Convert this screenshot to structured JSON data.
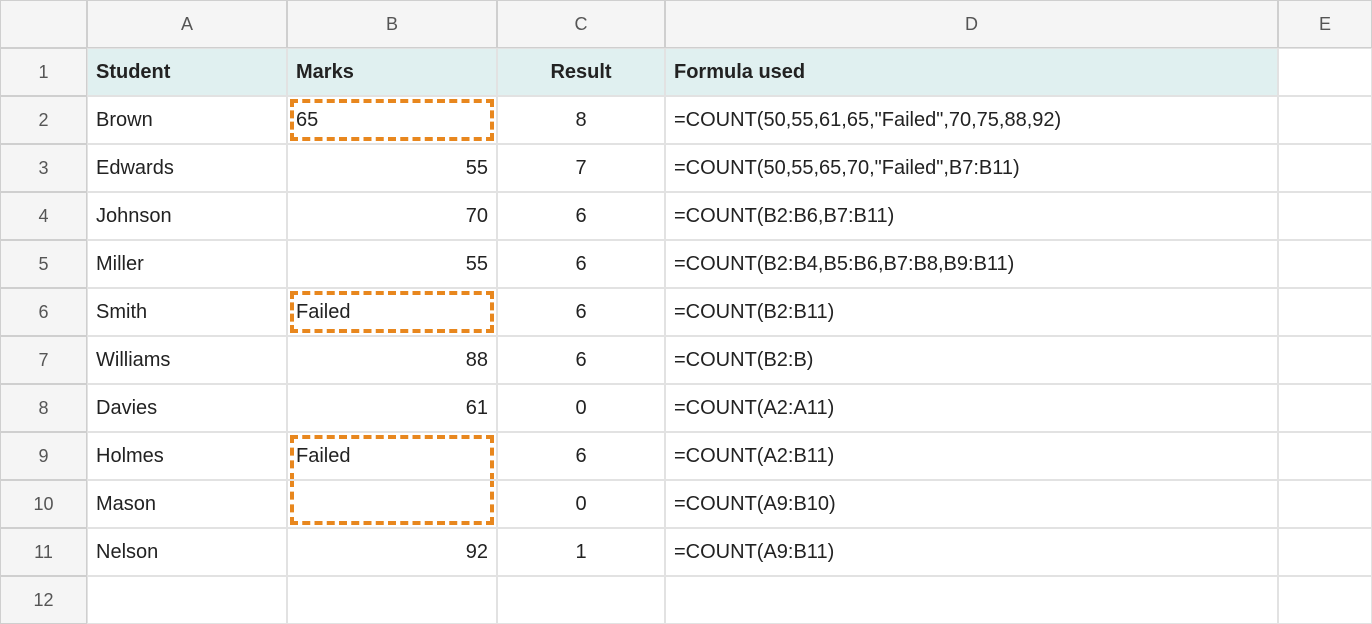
{
  "columns": [
    "A",
    "B",
    "C",
    "D",
    "E"
  ],
  "row_labels": [
    "1",
    "2",
    "3",
    "4",
    "5",
    "6",
    "7",
    "8",
    "9",
    "10",
    "11",
    "12"
  ],
  "header": {
    "A": "Student",
    "B": "Marks",
    "C": "Result",
    "D": "Formula used"
  },
  "rows": [
    {
      "A": "Brown",
      "B": "65",
      "C": "8",
      "D": "=COUNT(50,55,61,65,\"Failed\",70,75,88,92)"
    },
    {
      "A": "Edwards",
      "B": "55",
      "C": "7",
      "D": "=COUNT(50,55,65,70,\"Failed\",B7:B11)"
    },
    {
      "A": "Johnson",
      "B": "70",
      "C": "6",
      "D": "=COUNT(B2:B6,B7:B11)"
    },
    {
      "A": "Miller",
      "B": "55",
      "C": "6",
      "D": "=COUNT(B2:B4,B5:B6,B7:B8,B9:B11)"
    },
    {
      "A": "Smith",
      "B": "Failed",
      "C": "6",
      "D": "=COUNT(B2:B11)"
    },
    {
      "A": "Williams",
      "B": "88",
      "C": "6",
      "D": "=COUNT(B2:B)"
    },
    {
      "A": "Davies",
      "B": "61",
      "C": "0",
      "D": "=COUNT(A2:A11)"
    },
    {
      "A": "Holmes",
      "B": "Failed",
      "C": "6",
      "D": "=COUNT(A2:B11)"
    },
    {
      "A": "Mason",
      "B": "",
      "C": "0",
      "D": "=COUNT(A9:B10)"
    },
    {
      "A": "Nelson",
      "B": "92",
      "C": "1",
      "D": "=COUNT(A9:B11)"
    }
  ],
  "highlight_rows_B": [
    2,
    6,
    9,
    10
  ],
  "chart_data": {
    "type": "table",
    "columns": [
      "Student",
      "Marks",
      "Result",
      "Formula used"
    ],
    "rows": [
      [
        "Brown",
        65,
        8,
        "=COUNT(50,55,61,65,\"Failed\",70,75,88,92)"
      ],
      [
        "Edwards",
        55,
        7,
        "=COUNT(50,55,65,70,\"Failed\",B7:B11)"
      ],
      [
        "Johnson",
        70,
        6,
        "=COUNT(B2:B6,B7:B11)"
      ],
      [
        "Miller",
        55,
        6,
        "=COUNT(B2:B4,B5:B6,B7:B8,B9:B11)"
      ],
      [
        "Smith",
        "Failed",
        6,
        "=COUNT(B2:B11)"
      ],
      [
        "Williams",
        88,
        6,
        "=COUNT(B2:B)"
      ],
      [
        "Davies",
        61,
        0,
        "=COUNT(A2:A11)"
      ],
      [
        "Holmes",
        "Failed",
        6,
        "=COUNT(A2:B11)"
      ],
      [
        "Mason",
        "",
        0,
        "=COUNT(A9:B10)"
      ],
      [
        "Nelson",
        92,
        1,
        "=COUNT(A9:B11)"
      ]
    ]
  }
}
